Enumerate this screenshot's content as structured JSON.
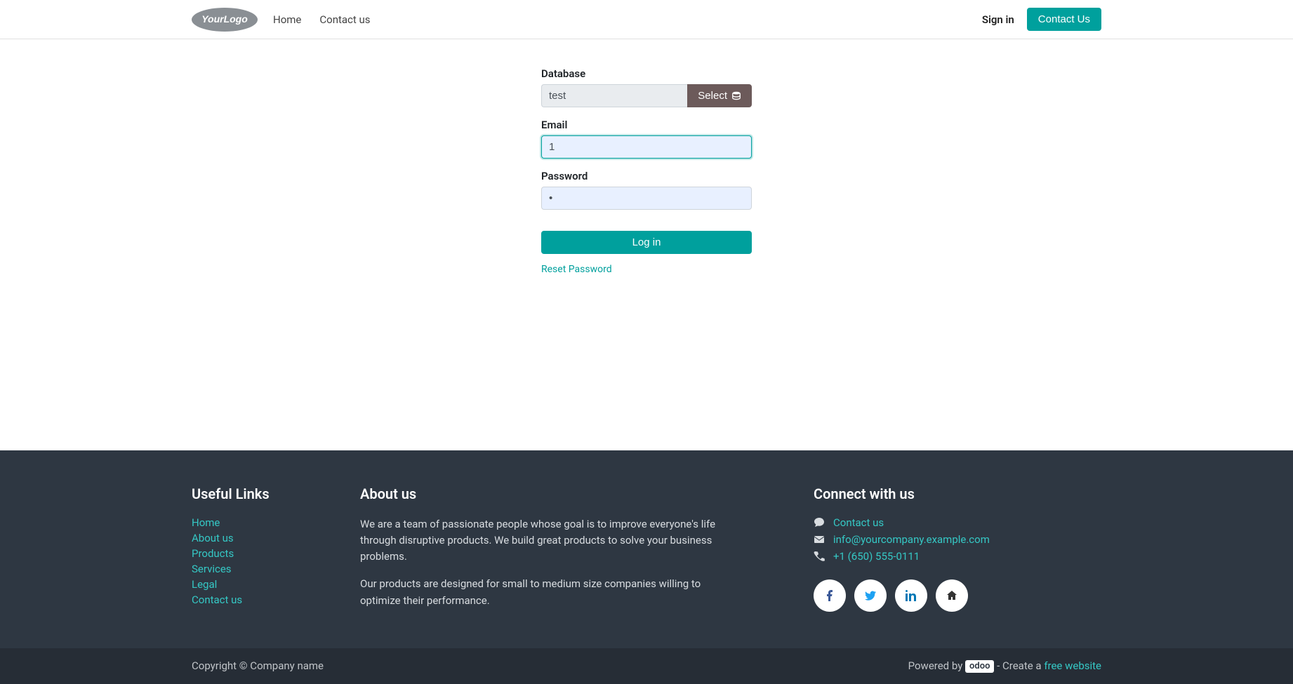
{
  "nav": {
    "logo_text": "YourLogo",
    "home": "Home",
    "contact": "Contact us",
    "signin": "Sign in",
    "contact_btn": "Contact Us"
  },
  "login": {
    "database_label": "Database",
    "database_value": "test",
    "select_label": "Select",
    "email_label": "Email",
    "email_value": "1",
    "password_label": "Password",
    "password_value": "•",
    "login_btn": "Log in",
    "reset_link": "Reset Password"
  },
  "footer": {
    "links_title": "Useful Links",
    "links": [
      "Home",
      "About us",
      "Products",
      "Services",
      "Legal",
      "Contact us"
    ],
    "about_title": "About us",
    "about_p1": "We are a team of passionate people whose goal is to improve everyone's life through disruptive products. We build great products to solve your business problems.",
    "about_p2": "Our products are designed for small to medium size companies willing to optimize their performance.",
    "connect_title": "Connect with us",
    "contact_link": "Contact us",
    "email_link": "info@yourcompany.example.com",
    "phone": "+1 (650) 555-0111",
    "copyright": "Copyright © Company name",
    "powered_by": "Powered by",
    "odoo_badge": "odoo",
    "create_prefix": " - Create a ",
    "free_website": "free website"
  }
}
